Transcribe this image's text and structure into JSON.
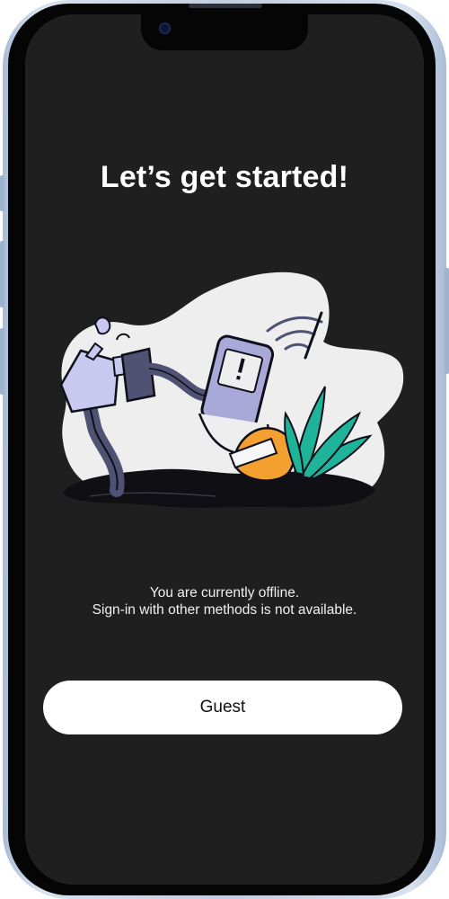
{
  "onboarding": {
    "title": "Let’s get started!",
    "offline_line1": "You are currently offline.",
    "offline_line2": "Sign-in with other methods is not available.",
    "guest_button_label": "Guest"
  },
  "illustration": {
    "description_icon": "unplugged-phone-illustration",
    "colors": {
      "blob": "#eeeeee",
      "outline": "#0f0f1a",
      "cable": "#4f5272",
      "plug_light": "#c9c9ef",
      "phone": "#a9a9d9",
      "orange": "#f4a030",
      "leaves": "#1fb39a"
    }
  },
  "colors": {
    "background": "#1f1f1f",
    "text": "#ffffff",
    "button_bg": "#ffffff",
    "button_text": "#111111"
  }
}
